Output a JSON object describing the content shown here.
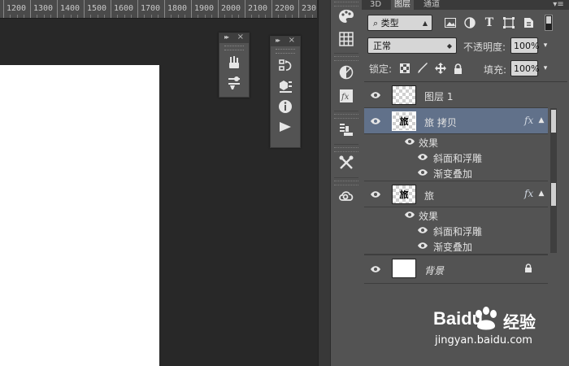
{
  "ruler": {
    "ticks": [
      "1200",
      "1300",
      "1400",
      "1500",
      "1600",
      "1700",
      "1800",
      "1900",
      "2000",
      "2100",
      "2200",
      "230"
    ]
  },
  "layers_panel": {
    "tabs": [
      {
        "label": "3D"
      },
      {
        "label": "图层"
      },
      {
        "label": "通道"
      }
    ],
    "filter": {
      "selected": "类型"
    },
    "blend_mode": "正常",
    "opacity_label": "不透明度:",
    "opacity_value": "100%",
    "lock_label": "锁定:",
    "fill_label": "填充:",
    "fill_value": "100%",
    "layers": [
      {
        "name": "图层 1",
        "thumb": "transparent",
        "selected": false,
        "fx": false
      },
      {
        "name": "旅 拷贝",
        "thumb": "glyph",
        "glyph": "旅",
        "selected": true,
        "fx": true,
        "fx_label": "fx",
        "effects_label": "效果",
        "effects": [
          "斜面和浮雕",
          "渐变叠加"
        ]
      },
      {
        "name": "旅",
        "thumb": "glyph",
        "glyph": "旅",
        "selected": false,
        "fx": true,
        "fx_label": "fx",
        "effects_label": "效果",
        "effects": [
          "斜面和浮雕",
          "渐变叠加"
        ]
      },
      {
        "name": "背景",
        "thumb": "white",
        "selected": false,
        "fx": false,
        "locked": true
      }
    ]
  },
  "dock_icons": [
    "palette-icon",
    "swatches-grid-icon",
    "adjustments-icon",
    "styles-fx-icon",
    "character-tool-preset-icon",
    "tools-icon",
    "creative-cloud-icon"
  ],
  "mini_panel_1": {
    "icons": [
      "brush-preset-icon",
      "brush-settings-icon"
    ]
  },
  "mini_panel_2": {
    "icons": [
      "history-icon",
      "3d-cube-icon",
      "info-icon",
      "actions-play-icon"
    ]
  },
  "watermark": {
    "brand": "Baidu",
    "cn": "经验",
    "url": "jingyan.baidu.com"
  }
}
